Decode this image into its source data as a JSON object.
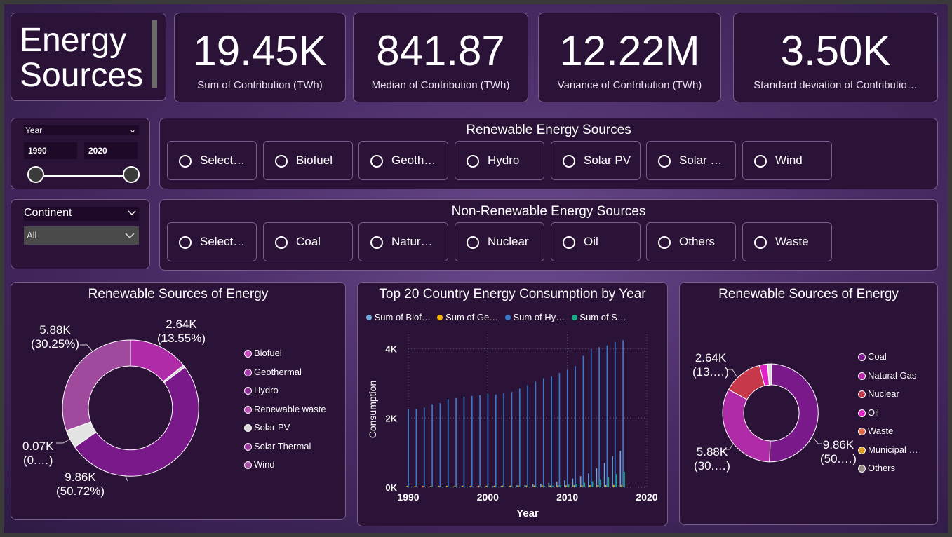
{
  "title": {
    "text": "Energy Sources"
  },
  "kpis": [
    {
      "value": "19.45K",
      "label": "Sum of Contribution (TWh)"
    },
    {
      "value": "841.87",
      "label": "Median of Contribution (TWh)"
    },
    {
      "value": "12.22M",
      "label": "Variance of Contribution (TWh)"
    },
    {
      "value": "3.50K",
      "label": "Standard deviation of Contributio…"
    }
  ],
  "year_slicer": {
    "label": "Year",
    "from": "1990",
    "to": "2020"
  },
  "continent_slicer": {
    "label": "Continent",
    "value": "All"
  },
  "renewable": {
    "title": "Renewable Energy Sources",
    "chips": [
      "Select…",
      "Biofuel",
      "Geoth…",
      "Hydro",
      "Solar PV",
      "Solar …",
      "Wind"
    ]
  },
  "nonrenewable": {
    "title": "Non-Renewable Energy Sources",
    "chips": [
      "Select…",
      "Coal",
      "Natur…",
      "Nuclear",
      "Oil",
      "Others",
      "Waste"
    ]
  },
  "donut_left": {
    "title": "Renewable Sources of Energy",
    "labels": [
      {
        "value": "2.64K",
        "pct": "(13.55%)"
      },
      {
        "value": "5.88K",
        "pct": "(30.25%)"
      },
      {
        "value": "0.07K",
        "pct": "(0.…)"
      },
      {
        "value": "9.86K",
        "pct": "(50.72%)"
      }
    ],
    "legend": [
      {
        "name": "Biofuel",
        "color": "#c94bc2"
      },
      {
        "name": "Geothermal",
        "color": "#a43aa8"
      },
      {
        "name": "Hydro",
        "color": "#8a2c91"
      },
      {
        "name": "Renewable waste",
        "color": "#b750b1"
      },
      {
        "name": "Solar PV",
        "color": "#d9d9d9"
      },
      {
        "name": "Solar Thermal",
        "color": "#9b38a0"
      },
      {
        "name": "Wind",
        "color": "#a552a5"
      }
    ]
  },
  "donut_right": {
    "title": "Renewable Sources of Energy",
    "labels": [
      {
        "value": "2.64K",
        "pct": "(13.…)"
      },
      {
        "value": "5.88K",
        "pct": "(30.…)"
      },
      {
        "value": "9.86K",
        "pct": "(50.…)"
      }
    ],
    "legend": [
      {
        "name": "Coal",
        "color": "#7a1a8a"
      },
      {
        "name": "Natural Gas",
        "color": "#b02ba8"
      },
      {
        "name": "Nuclear",
        "color": "#c6384a"
      },
      {
        "name": "Oil",
        "color": "#e020c8"
      },
      {
        "name": "Waste",
        "color": "#e0684a"
      },
      {
        "name": "Municipal …",
        "color": "#e0a020"
      },
      {
        "name": "Others",
        "color": "#9a8f88"
      }
    ]
  },
  "bar_chart": {
    "title": "Top 20 Country Energy Consumption by Year",
    "legend": [
      {
        "name": "Sum of Biof…",
        "color": "#6fa8dc"
      },
      {
        "name": "Sum of Ge…",
        "color": "#f2b400"
      },
      {
        "name": "Sum of Hy…",
        "color": "#3a78c9"
      },
      {
        "name": "Sum of S…",
        "color": "#1aa887"
      }
    ]
  },
  "chart_data": {
    "type": "bar",
    "title": "Top 20 Country Energy Consumption by Year",
    "xlabel": "Year",
    "ylabel": "Consumption",
    "xlim": [
      1990,
      2020
    ],
    "ylim": [
      0,
      4500
    ],
    "x_ticks": [
      "1990",
      "2000",
      "2010",
      "2020"
    ],
    "y_ticks": [
      "0K",
      "2K",
      "4K"
    ],
    "x": [
      1990,
      1991,
      1992,
      1993,
      1994,
      1995,
      1996,
      1997,
      1998,
      1999,
      2000,
      2001,
      2002,
      2003,
      2004,
      2005,
      2006,
      2007,
      2008,
      2009,
      2010,
      2011,
      2012,
      2013,
      2014,
      2015,
      2016,
      2017
    ],
    "series": [
      {
        "name": "Sum of Biof…",
        "values": [
          20,
          20,
          20,
          22,
          22,
          24,
          25,
          26,
          28,
          30,
          32,
          35,
          40,
          45,
          55,
          65,
          80,
          100,
          130,
          160,
          200,
          250,
          320,
          400,
          550,
          700,
          900,
          1050
        ]
      },
      {
        "name": "Sum of Ge…",
        "values": [
          40,
          40,
          41,
          41,
          42,
          43,
          43,
          44,
          44,
          45,
          46,
          46,
          47,
          48,
          49,
          50,
          50,
          52,
          53,
          54,
          55,
          56,
          57,
          58,
          60,
          62,
          64,
          66
        ]
      },
      {
        "name": "Sum of Hy…",
        "values": [
          2250,
          2260,
          2300,
          2400,
          2430,
          2550,
          2580,
          2620,
          2640,
          2660,
          2700,
          2680,
          2720,
          2760,
          2850,
          2950,
          3050,
          3150,
          3200,
          3300,
          3400,
          3500,
          3800,
          4000,
          4050,
          4100,
          4200,
          4250
        ]
      },
      {
        "name": "Sum of S…",
        "values": [
          5,
          5,
          5,
          6,
          6,
          6,
          7,
          7,
          8,
          9,
          10,
          12,
          14,
          16,
          18,
          22,
          28,
          35,
          45,
          60,
          75,
          95,
          130,
          170,
          230,
          300,
          380,
          450
        ]
      }
    ]
  }
}
